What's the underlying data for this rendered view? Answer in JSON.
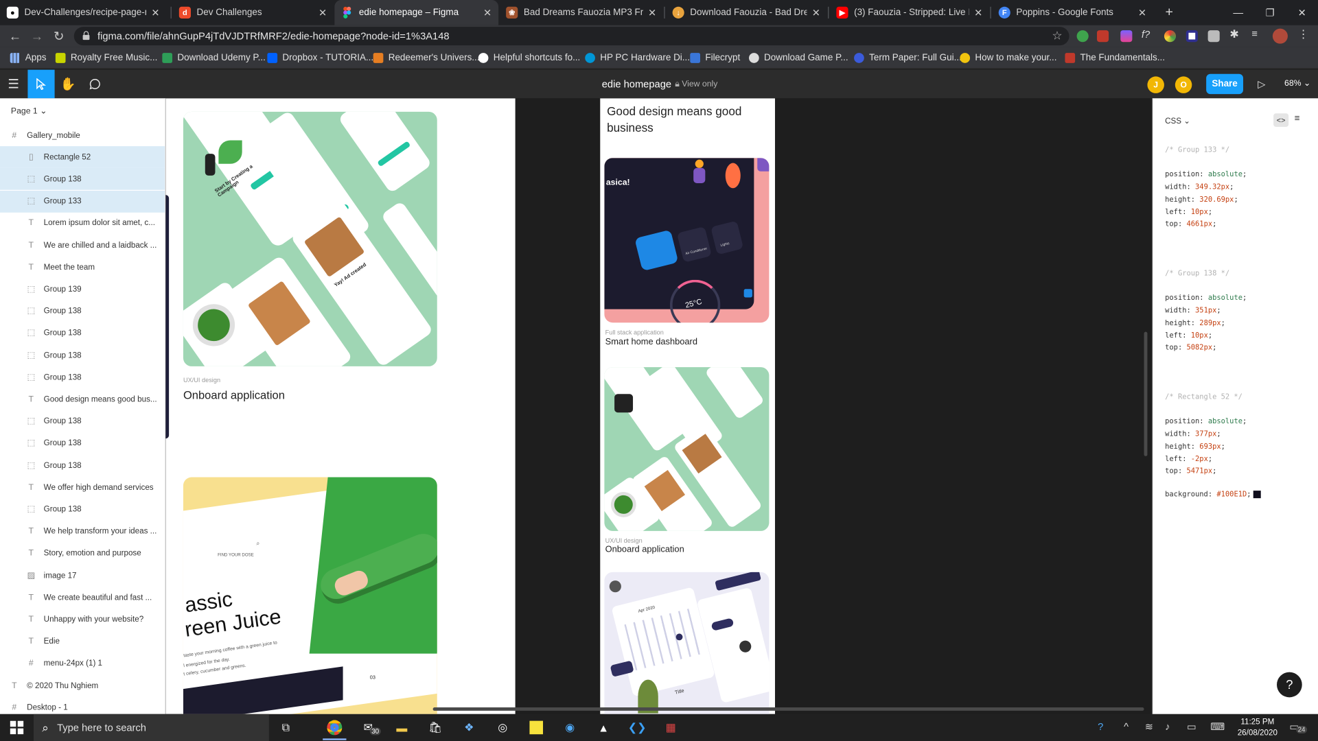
{
  "browser": {
    "tabs": [
      {
        "title": "Dev-Challenges/recipe-page-ma",
        "icon": "github-icon"
      },
      {
        "title": "Dev Challenges",
        "icon": "devchallenges-icon"
      },
      {
        "title": "edie homepage – Figma",
        "icon": "figma-icon",
        "active": true
      },
      {
        "title": "Bad Dreams Fauozia MP3 Free D",
        "icon": "paw-icon"
      },
      {
        "title": "Download Faouzia - Bad Dreams",
        "icon": "download-icon"
      },
      {
        "title": "(3) Faouzia - Stripped: Live In",
        "icon": "youtube-icon"
      },
      {
        "title": "Poppins - Google Fonts",
        "icon": "google-fonts-icon"
      }
    ],
    "new_tab": "+",
    "url": "figma.com/file/ahnGupP4jTdVJDTRfMRF2/edie-homepage?node-id=1%3A148",
    "bookmarks": [
      {
        "label": "Apps",
        "icon": "apps-grid-icon"
      },
      {
        "label": "Royalty Free Music...",
        "icon": "music-icon"
      },
      {
        "label": "Download Udemy P...",
        "icon": "udemy-icon"
      },
      {
        "label": "Dropbox - TUTORIA...",
        "icon": "dropbox-icon"
      },
      {
        "label": "Redeemer's Univers...",
        "icon": "university-icon"
      },
      {
        "label": "Helpful shortcuts fo...",
        "icon": "github-icon"
      },
      {
        "label": "HP PC Hardware Di...",
        "icon": "hp-icon"
      },
      {
        "label": "Filecrypt",
        "icon": "shield-icon"
      },
      {
        "label": "Download Game P...",
        "icon": "game-icon"
      },
      {
        "label": "Term Paper: Full Gui...",
        "icon": "paper-icon"
      },
      {
        "label": "How to make your...",
        "icon": "lightbulb-icon"
      },
      {
        "label": "The Fundamentals...",
        "icon": "book-icon"
      }
    ]
  },
  "figma": {
    "file_title": "edie homepage",
    "view_mode": "View only",
    "avatars": [
      "J",
      "O"
    ],
    "share_label": "Share",
    "zoom": "68%",
    "page_selector": "Page 1",
    "layers": [
      {
        "name": "Gallery_mobile",
        "type": "frame",
        "indent": 0
      },
      {
        "name": "Rectangle 52",
        "type": "rect",
        "indent": 1,
        "selected": true
      },
      {
        "name": "Group 138",
        "type": "group",
        "indent": 1,
        "selected": true
      },
      {
        "name": "Group 133",
        "type": "group",
        "indent": 1,
        "selected": true
      },
      {
        "name": "Lorem ipsum dolor sit amet, c...",
        "type": "text",
        "indent": 1
      },
      {
        "name": "We are chilled and a laidback ...",
        "type": "text",
        "indent": 1
      },
      {
        "name": "Meet the team",
        "type": "text",
        "indent": 1
      },
      {
        "name": "Group 139",
        "type": "group",
        "indent": 1
      },
      {
        "name": "Group 138",
        "type": "group",
        "indent": 1
      },
      {
        "name": "Group 138",
        "type": "group",
        "indent": 1
      },
      {
        "name": "Group 138",
        "type": "group",
        "indent": 1
      },
      {
        "name": "Group 138",
        "type": "group",
        "indent": 1
      },
      {
        "name": "Good design means good bus...",
        "type": "text",
        "indent": 1
      },
      {
        "name": "Group 138",
        "type": "group",
        "indent": 1
      },
      {
        "name": "Group 138",
        "type": "group",
        "indent": 1
      },
      {
        "name": "Group 138",
        "type": "group",
        "indent": 1
      },
      {
        "name": "We offer high demand services",
        "type": "text",
        "indent": 1
      },
      {
        "name": "Group 138",
        "type": "group",
        "indent": 1
      },
      {
        "name": "We help transform your ideas ...",
        "type": "text",
        "indent": 1
      },
      {
        "name": "Story, emotion and purpose",
        "type": "text",
        "indent": 1
      },
      {
        "name": "image 17",
        "type": "image",
        "indent": 1
      },
      {
        "name": "We create beautiful and fast ...",
        "type": "text",
        "indent": 1
      },
      {
        "name": "Unhappy with your website?",
        "type": "text",
        "indent": 1
      },
      {
        "name": "Edie",
        "type": "text",
        "indent": 1
      },
      {
        "name": "menu-24px (1) 1",
        "type": "frame",
        "indent": 1
      },
      {
        "name": "© 2020 Thu Nghiem",
        "type": "text",
        "indent": 0
      },
      {
        "name": "Desktop - 1",
        "type": "frame",
        "indent": 0
      }
    ],
    "canvas": {
      "left_card1": {
        "category": "UX/UI design",
        "title": "Onboard application",
        "mock_texts": [
          "Start by Creating a Campaign",
          "Yay! Ad created"
        ]
      },
      "left_card2": {
        "mock_texts": [
          "FIND YOUR DOSE",
          "assic",
          "reen Juice",
          "taste your morning coffee with a green juice to",
          "l energized for the day.",
          "t celery, cucumber and greens.",
          "03"
        ]
      },
      "mobile_headline": "Good design means good business",
      "mobile_cards": [
        {
          "category": "Full stack application",
          "title": "Smart home dashboard",
          "mock_texts": [
            "asica!",
            "25°C",
            "Air Conditioner",
            "Lights"
          ]
        },
        {
          "category": "UX/UI design",
          "title": "Onboard application"
        },
        {
          "mock_texts": [
            "Apr 2020",
            "Title"
          ]
        }
      ]
    },
    "inspect": {
      "format": "CSS",
      "blocks": [
        {
          "comment": "/* Group 133 */",
          "props": [
            {
              "k": "position",
              "v": "absolute",
              "t": "kw"
            },
            {
              "k": "width",
              "v": "349.32px"
            },
            {
              "k": "height",
              "v": "320.69px"
            },
            {
              "k": "left",
              "v": "10px"
            },
            {
              "k": "top",
              "v": "4661px"
            }
          ]
        },
        {
          "comment": "/* Group 138 */",
          "props": [
            {
              "k": "position",
              "v": "absolute",
              "t": "kw"
            },
            {
              "k": "width",
              "v": "351px"
            },
            {
              "k": "height",
              "v": "289px"
            },
            {
              "k": "left",
              "v": "10px"
            },
            {
              "k": "top",
              "v": "5082px"
            }
          ]
        },
        {
          "comment": "/* Rectangle 52 */",
          "props": [
            {
              "k": "position",
              "v": "absolute",
              "t": "kw"
            },
            {
              "k": "width",
              "v": "377px"
            },
            {
              "k": "height",
              "v": "693px"
            },
            {
              "k": "left",
              "v": "-2px"
            },
            {
              "k": "top",
              "v": "5471px"
            }
          ]
        }
      ],
      "background_line": {
        "k": "background",
        "v": "#100E1D",
        "color": "#100e1d"
      }
    },
    "help": "?"
  },
  "taskbar": {
    "search_placeholder": "Type here to search",
    "mail_badge": "30",
    "time": "11:25 PM",
    "date": "26/08/2020",
    "notifications": "24"
  },
  "colors": {
    "figma_blue": "#18a0fb",
    "mint": "#9fd6b4",
    "teal": "#22c6a3",
    "juice_green": "#3aa844",
    "yellow": "#f8e08f",
    "dark_navy": "#1c1b2e"
  }
}
